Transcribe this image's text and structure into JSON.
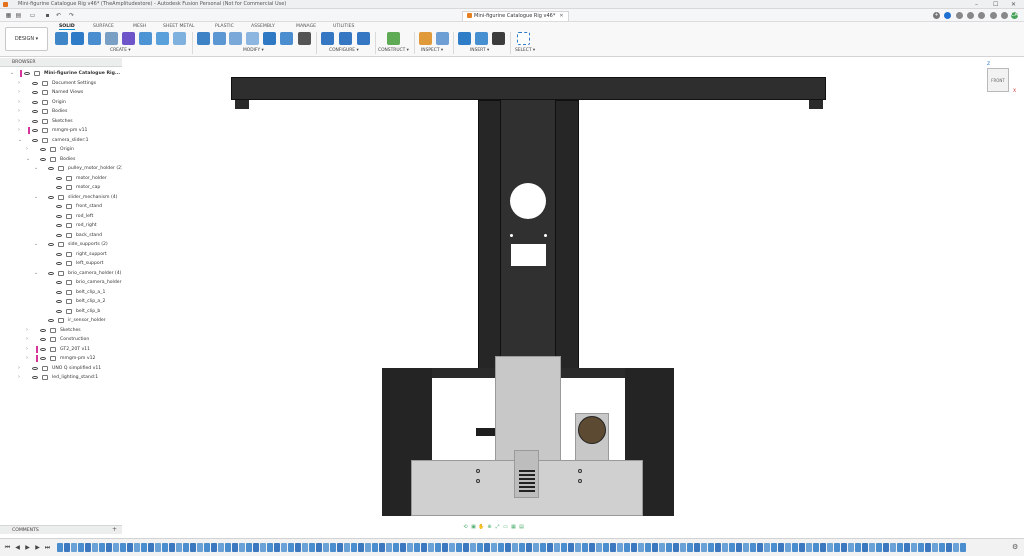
{
  "window": {
    "title": "Mini-figurine Catalogue Rig v46* (TheAmplitudestore) - Autodesk Fusion Personal (Not for Commercial Use)",
    "controls": {
      "minimize": "–",
      "maximize": "☐",
      "close": "✕"
    }
  },
  "doc_tab": {
    "label": "Mini-figurine Catalogue Rig v46*",
    "close": "✕"
  },
  "qat_right": {
    "avatar": "CA"
  },
  "workspace": {
    "label": "DESIGN ▾"
  },
  "ribbon_tabs": [
    "SOLID",
    "SURFACE",
    "MESH",
    "SHEET METAL",
    "PLASTIC",
    "ASSEMBLY",
    "MANAGE",
    "UTILITIES"
  ],
  "ribbon_groups": [
    "CREATE ▾",
    "MODIFY ▾",
    "CONFIGURE ▾",
    "CONSTRUCT ▾",
    "INSPECT ▾",
    "INSERT ▾",
    "SELECT ▾"
  ],
  "browser": {
    "header": "BROWSER",
    "items": [
      {
        "label": "Mini-figurine Catalogue Rig...",
        "exp": "⌄",
        "pin": true
      },
      {
        "label": "Document Settings",
        "exp": "›"
      },
      {
        "label": "Named Views",
        "exp": "›"
      },
      {
        "label": "Origin",
        "exp": "›"
      },
      {
        "label": "Bodies",
        "exp": "›"
      },
      {
        "label": "Sketches",
        "exp": "›"
      },
      {
        "label": "mmgm-pm v11",
        "exp": "›",
        "pin": true
      },
      {
        "label": "camera_slider:1",
        "exp": "⌄"
      },
      {
        "label": "Origin",
        "exp": "›"
      },
      {
        "label": "Bodies",
        "exp": "⌄"
      },
      {
        "label": "pulley_motor_holder (2)",
        "exp": "⌄"
      },
      {
        "label": "motor_holder",
        "exp": ""
      },
      {
        "label": "motor_cap",
        "exp": ""
      },
      {
        "label": "slider_mechanism (4)",
        "exp": "⌄"
      },
      {
        "label": "front_stand",
        "exp": ""
      },
      {
        "label": "rod_left",
        "exp": ""
      },
      {
        "label": "rod_right",
        "exp": ""
      },
      {
        "label": "back_stand",
        "exp": ""
      },
      {
        "label": "side_supports (2)",
        "exp": "⌄"
      },
      {
        "label": "right_support",
        "exp": ""
      },
      {
        "label": "left_support",
        "exp": ""
      },
      {
        "label": "brio_camera_holder (4)",
        "exp": "⌄"
      },
      {
        "label": "brio_camera_holder",
        "exp": ""
      },
      {
        "label": "belt_clip_a_1",
        "exp": ""
      },
      {
        "label": "belt_clip_a_2",
        "exp": ""
      },
      {
        "label": "belt_clip_b",
        "exp": ""
      },
      {
        "label": "ir_sensor_holder",
        "exp": ""
      },
      {
        "label": "Sketches",
        "exp": "›"
      },
      {
        "label": "Construction",
        "exp": "›"
      },
      {
        "label": "GT2_20T v11",
        "exp": "›",
        "pin": true
      },
      {
        "label": "mmgm-pm v12",
        "exp": "›",
        "pin": true
      },
      {
        "label": "UNO Q simplified v11",
        "exp": "›"
      },
      {
        "label": "led_lighting_stand:1",
        "exp": "›"
      }
    ]
  },
  "comments": {
    "label": "COMMENTS",
    "add": "+"
  },
  "viewcube": {
    "face": "FRONT",
    "z": "Z",
    "x": "X"
  },
  "colors": {
    "accent": "#0696d7",
    "dark_body": "#2b2b2b",
    "grey_body": "#c8c8c8",
    "pink_pin": "#d6349c"
  }
}
